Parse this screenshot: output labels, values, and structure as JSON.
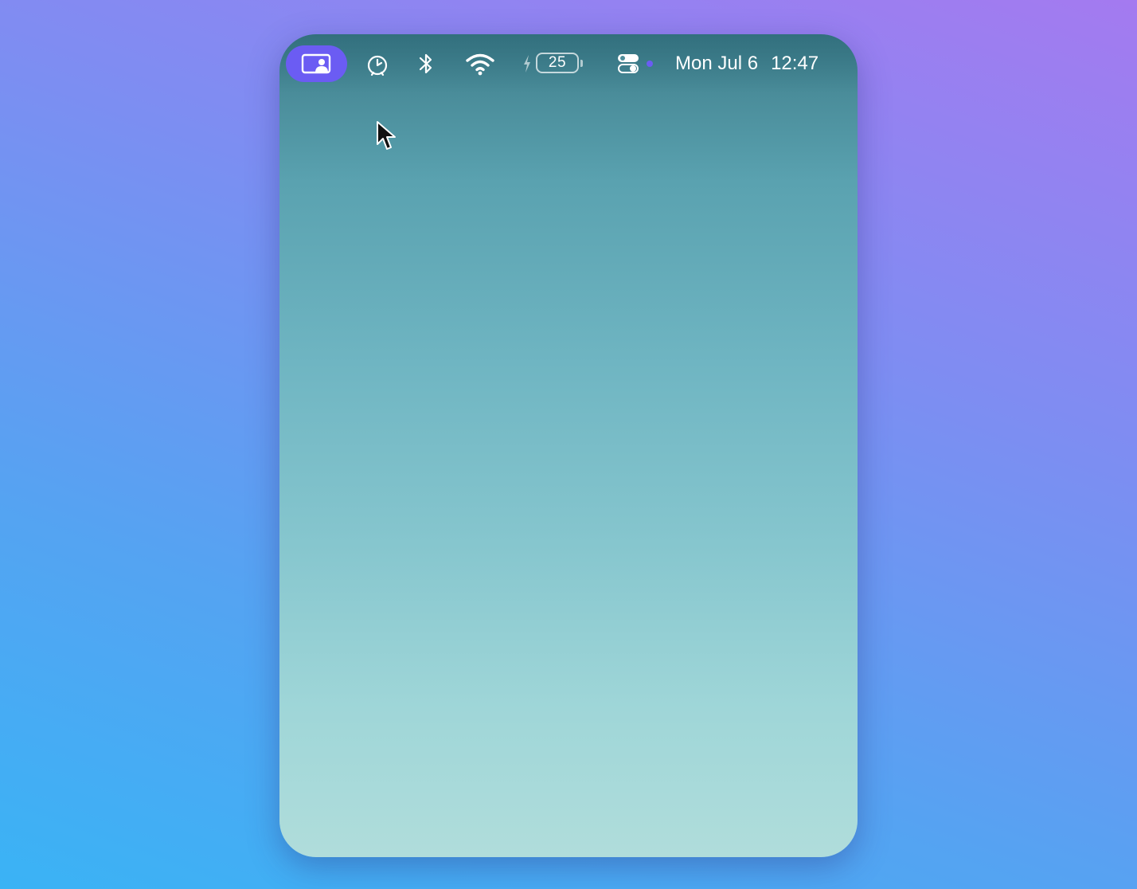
{
  "menubar": {
    "app_icon": "screen-person-icon",
    "status_icons": [
      "clock-icon",
      "bluetooth-icon",
      "wifi-icon"
    ],
    "battery": {
      "level": "25",
      "charging": true,
      "icon": "battery-icon"
    },
    "control_center_icon": "control-center-icon",
    "date": "Mon Jul 6",
    "time": "12:47"
  },
  "colors": {
    "accent": "#6b5cf3",
    "wallpaper_top": "#3f7e8b",
    "wallpaper_bottom": "#b0dddb"
  },
  "cursor_icon": "pointer-cursor-icon"
}
